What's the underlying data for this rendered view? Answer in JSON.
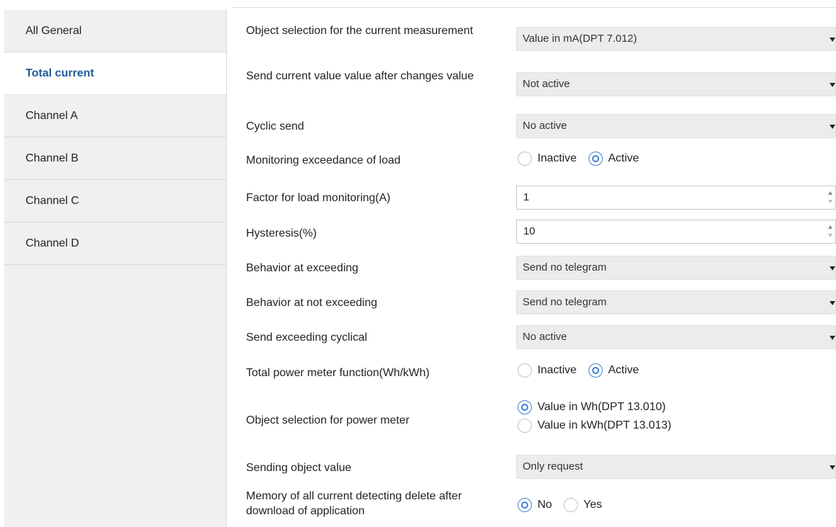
{
  "sidebar": {
    "items": [
      {
        "label": "All General"
      },
      {
        "label": "Total current"
      },
      {
        "label": "Channel A"
      },
      {
        "label": "Channel B"
      },
      {
        "label": "Channel C"
      },
      {
        "label": "Channel D"
      }
    ],
    "active_index": 1
  },
  "params": {
    "object_selection": {
      "label": "Object selection for the current measurement",
      "value": "Value in mA(DPT 7.012)"
    },
    "send_after_change": {
      "label": "Send current value value after changes value",
      "value": "Not active"
    },
    "cyclic_send": {
      "label": "Cyclic send",
      "value": "No active"
    },
    "monitoring_exceedance": {
      "label": "Monitoring exceedance of load",
      "options": [
        "Inactive",
        "Active"
      ],
      "selected": "Active"
    },
    "factor_load": {
      "label": "Factor for load monitoring(A)",
      "value": "1"
    },
    "hysteresis": {
      "label": "Hysteresis(%)",
      "value": "10"
    },
    "behavior_exceeding": {
      "label": "Behavior at exceeding",
      "value": "Send no telegram"
    },
    "behavior_not_exceeding": {
      "label": "Behavior at not exceeding",
      "value": "Send no telegram"
    },
    "send_exceeding_cyclical": {
      "label": "Send exceeding cyclical",
      "value": "No active"
    },
    "total_power_meter": {
      "label": "Total power meter function(Wh/kWh)",
      "options": [
        "Inactive",
        "Active"
      ],
      "selected": "Active"
    },
    "object_power_meter": {
      "label": "Object selection for power meter",
      "options": [
        "Value in Wh(DPT 13.010)",
        "Value in kWh(DPT 13.013)"
      ],
      "selected": "Value in Wh(DPT 13.010)"
    },
    "sending_object_value": {
      "label": "Sending object value",
      "value": "Only request"
    },
    "memory_delete": {
      "label": "Memory of all current detecting delete after download of application",
      "options": [
        "No",
        "Yes"
      ],
      "selected": "No"
    }
  },
  "colors": {
    "accent": "#1f5b99",
    "radio": "#3f7fd1",
    "sidebar_bg": "#f0f0f0",
    "select_bg": "#ececec"
  }
}
